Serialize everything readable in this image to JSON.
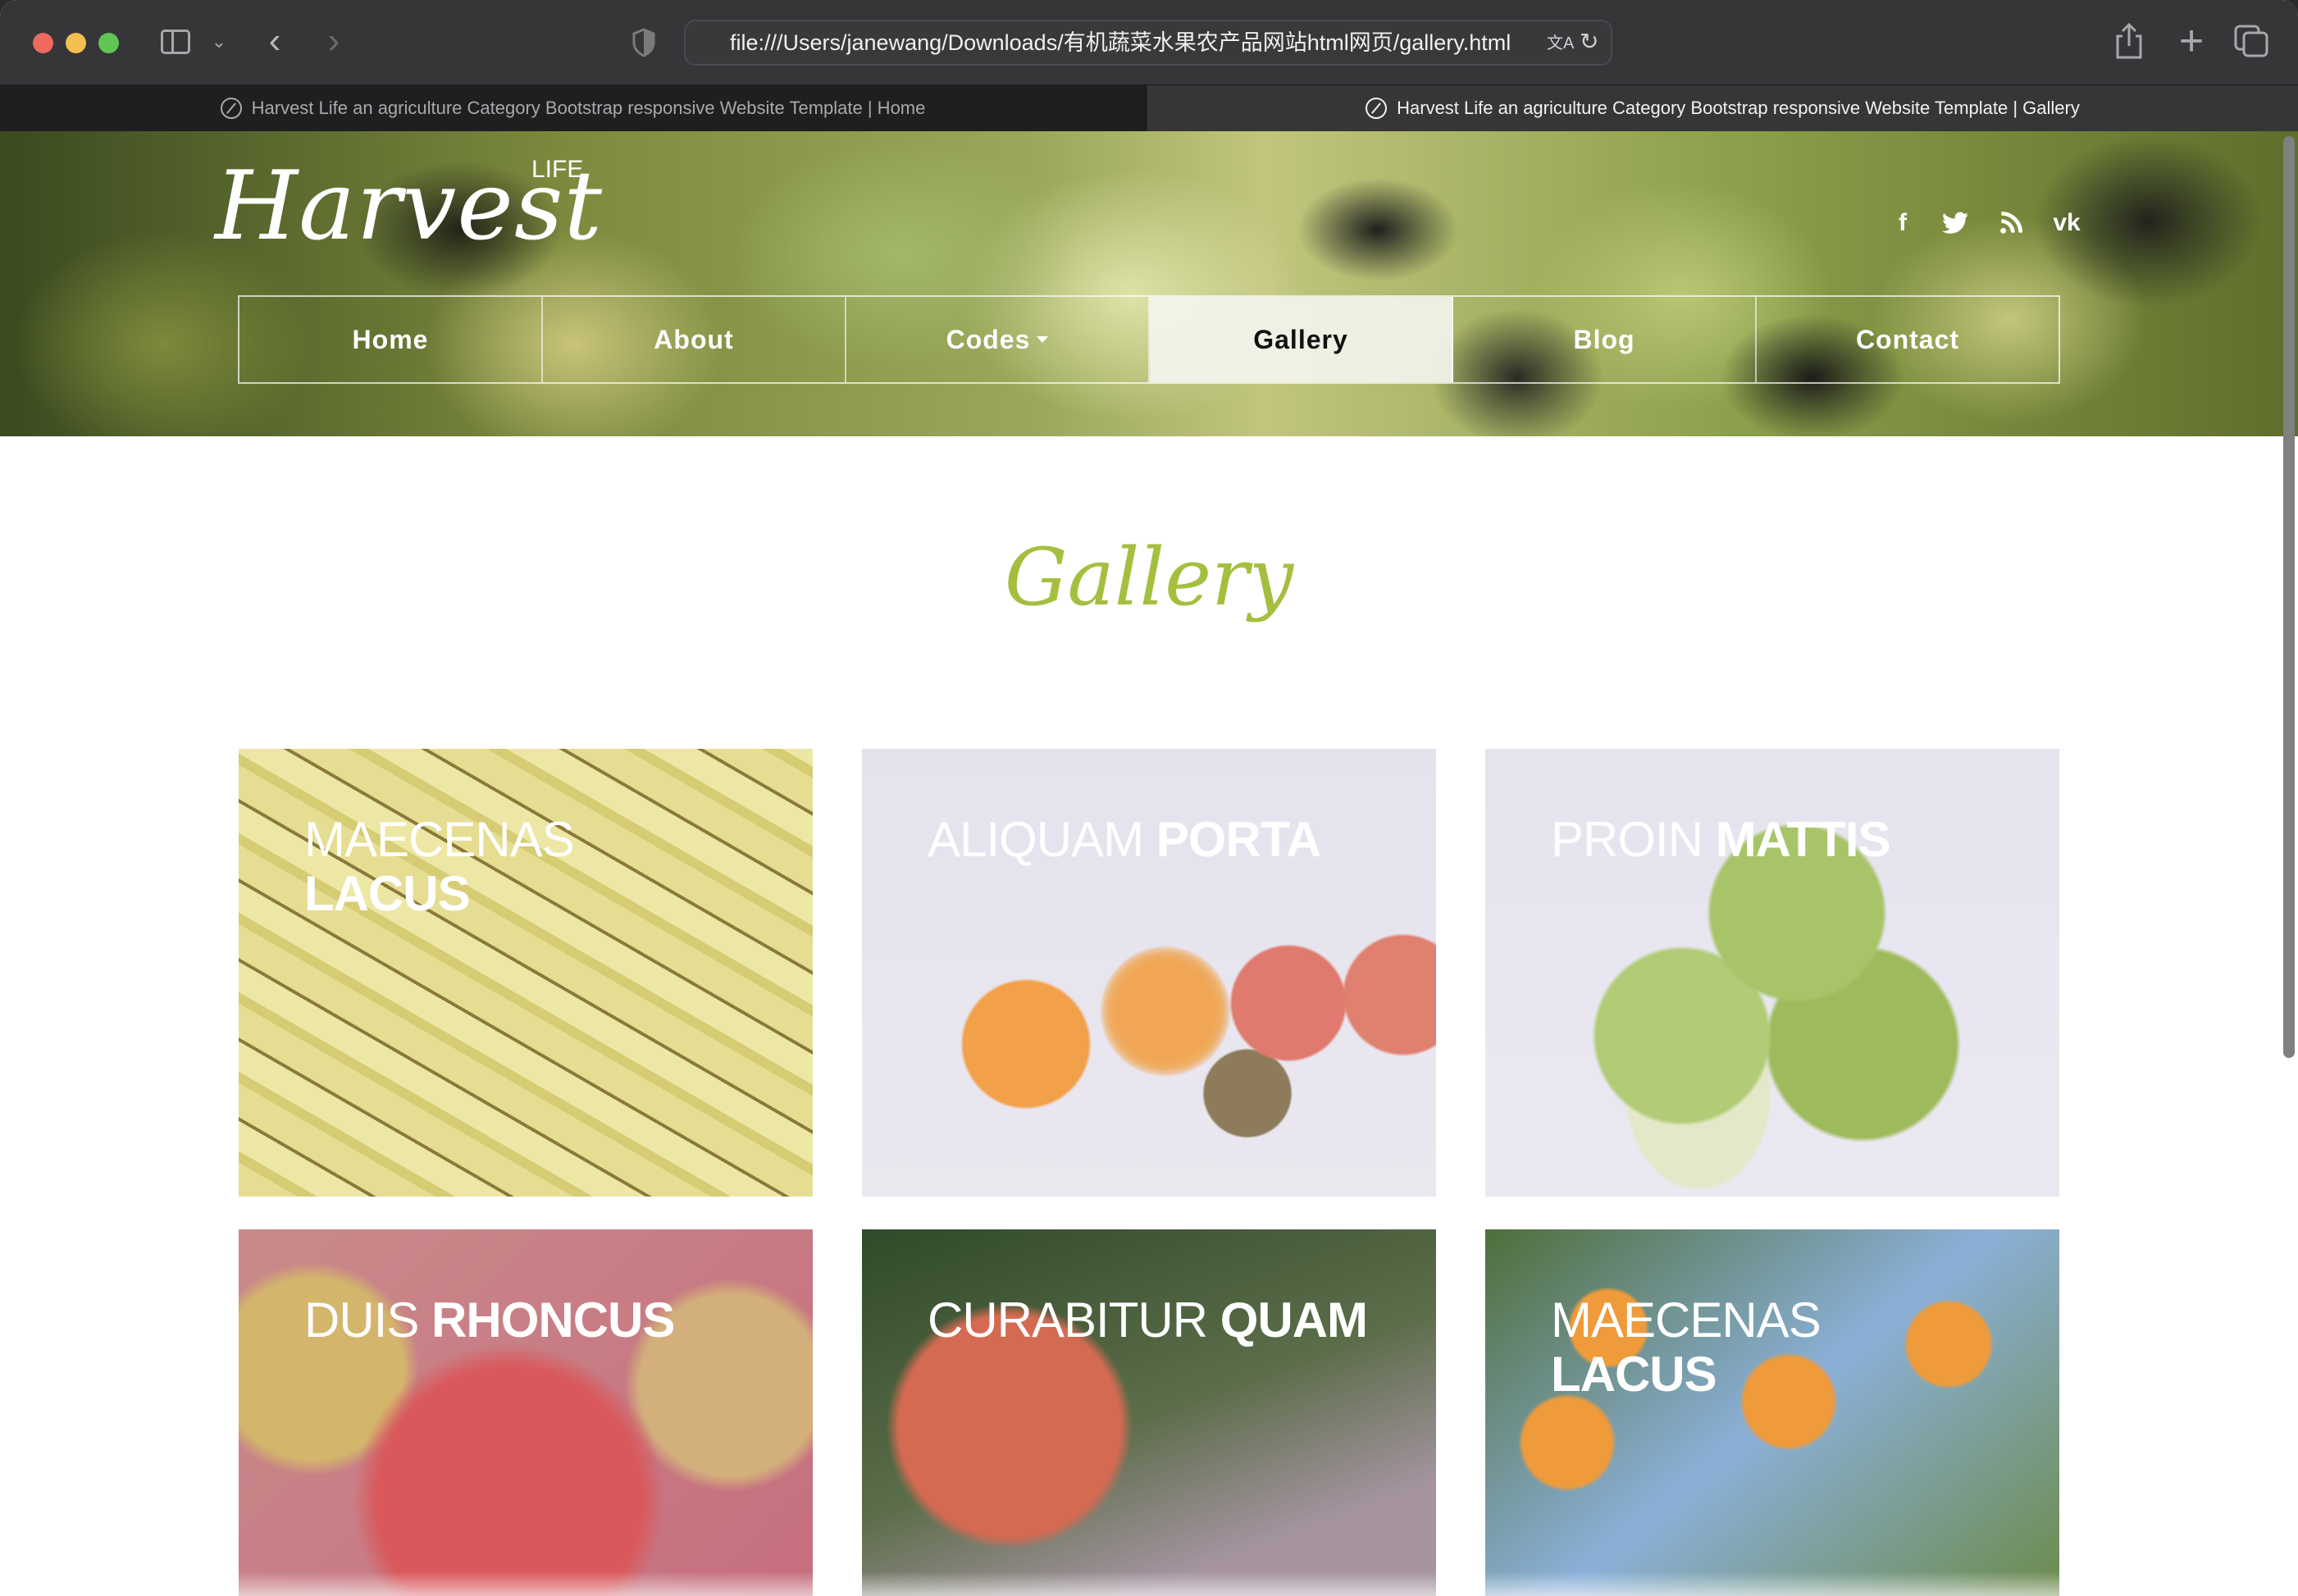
{
  "browser": {
    "url": "file:///Users/janewang/Downloads/有机蔬菜水果农产品网站html网页/gallery.html",
    "tabs": [
      {
        "title": "Harvest Life an agriculture Category Bootstrap responsive Website Template | Home",
        "active": false
      },
      {
        "title": "Harvest Life an agriculture Category Bootstrap responsive Website Template | Gallery",
        "active": true
      }
    ],
    "icons": {
      "back": "‹",
      "forward": "›",
      "chevron": "⌄",
      "translate": "文A",
      "reload": "↻",
      "new_tab": "+"
    }
  },
  "site": {
    "logo": "Harvest",
    "logo_sub": "LIFE",
    "social": [
      {
        "name": "facebook",
        "glyph": "f"
      },
      {
        "name": "twitter",
        "glyph": "🐦"
      },
      {
        "name": "rss",
        "glyph": "◔"
      },
      {
        "name": "vk",
        "glyph": "vk"
      }
    ],
    "nav": [
      {
        "label": "Home",
        "active": false
      },
      {
        "label": "About",
        "active": false
      },
      {
        "label": "Codes",
        "active": false,
        "dropdown": true
      },
      {
        "label": "Gallery",
        "active": true
      },
      {
        "label": "Blog",
        "active": false
      },
      {
        "label": "Contact",
        "active": false
      }
    ]
  },
  "gallery": {
    "title": "Gallery",
    "title_color": "#a4bf3e",
    "items": [
      {
        "light": "MAECENAS",
        "bold": "LACUS",
        "image": "bananas"
      },
      {
        "light": "ALIQUAM",
        "bold": "PORTA",
        "image": "oranges-kiwi-apples"
      },
      {
        "light": "PROIN",
        "bold": "MATTIS",
        "image": "green-apples"
      },
      {
        "light": "DUIS",
        "bold": "RHONCUS",
        "image": "red-apples"
      },
      {
        "light": "CURABITUR",
        "bold": "QUAM",
        "image": "apple-on-tree"
      },
      {
        "light": "MAECENAS",
        "bold": "LACUS",
        "image": "orange-tree"
      }
    ]
  }
}
